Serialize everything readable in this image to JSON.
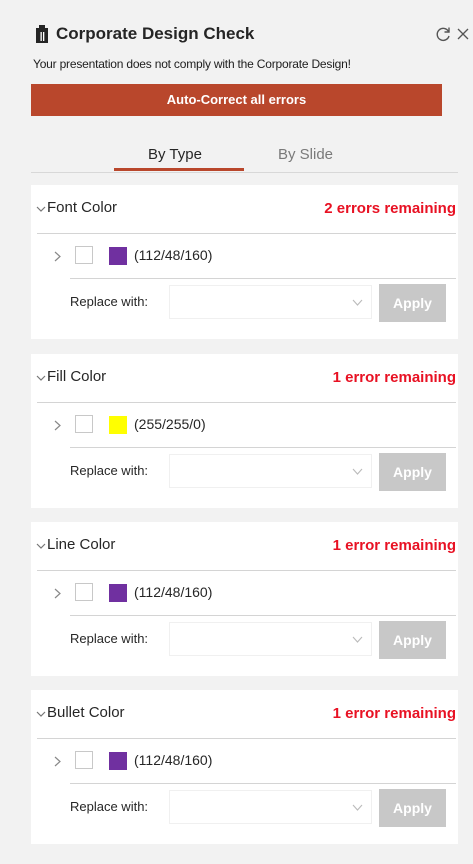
{
  "header": {
    "title": "Corporate Design Check",
    "subtitle": "Your presentation does not comply with the Corporate Design!",
    "logo_icon": "clipboard-icon",
    "refresh_icon": "refresh-icon",
    "close_icon": "close-icon"
  },
  "actions": {
    "autocorrect_label": "Auto-Correct all errors"
  },
  "tabs": [
    {
      "label": "By Type",
      "active": true
    },
    {
      "label": "By Slide",
      "active": false
    }
  ],
  "colors": {
    "accent": "#b9472c",
    "error": "#e81123",
    "apply_disabled": "#c8c8c8"
  },
  "cards": [
    {
      "name": "Font Color",
      "errors": "2 errors remaining",
      "swatch": "#7030a0",
      "rgb": "(112/48/160)",
      "replace_label": "Replace with:",
      "apply_label": "Apply"
    },
    {
      "name": "Fill Color",
      "errors": "1 error remaining",
      "swatch": "#ffff00",
      "rgb": "(255/255/0)",
      "replace_label": "Replace with:",
      "apply_label": "Apply"
    },
    {
      "name": "Line Color",
      "errors": "1 error remaining",
      "swatch": "#7030a0",
      "rgb": "(112/48/160)",
      "replace_label": "Replace with:",
      "apply_label": "Apply"
    },
    {
      "name": "Bullet Color",
      "errors": "1 error remaining",
      "swatch": "#7030a0",
      "rgb": "(112/48/160)",
      "replace_label": "Replace with:",
      "apply_label": "Apply"
    }
  ]
}
